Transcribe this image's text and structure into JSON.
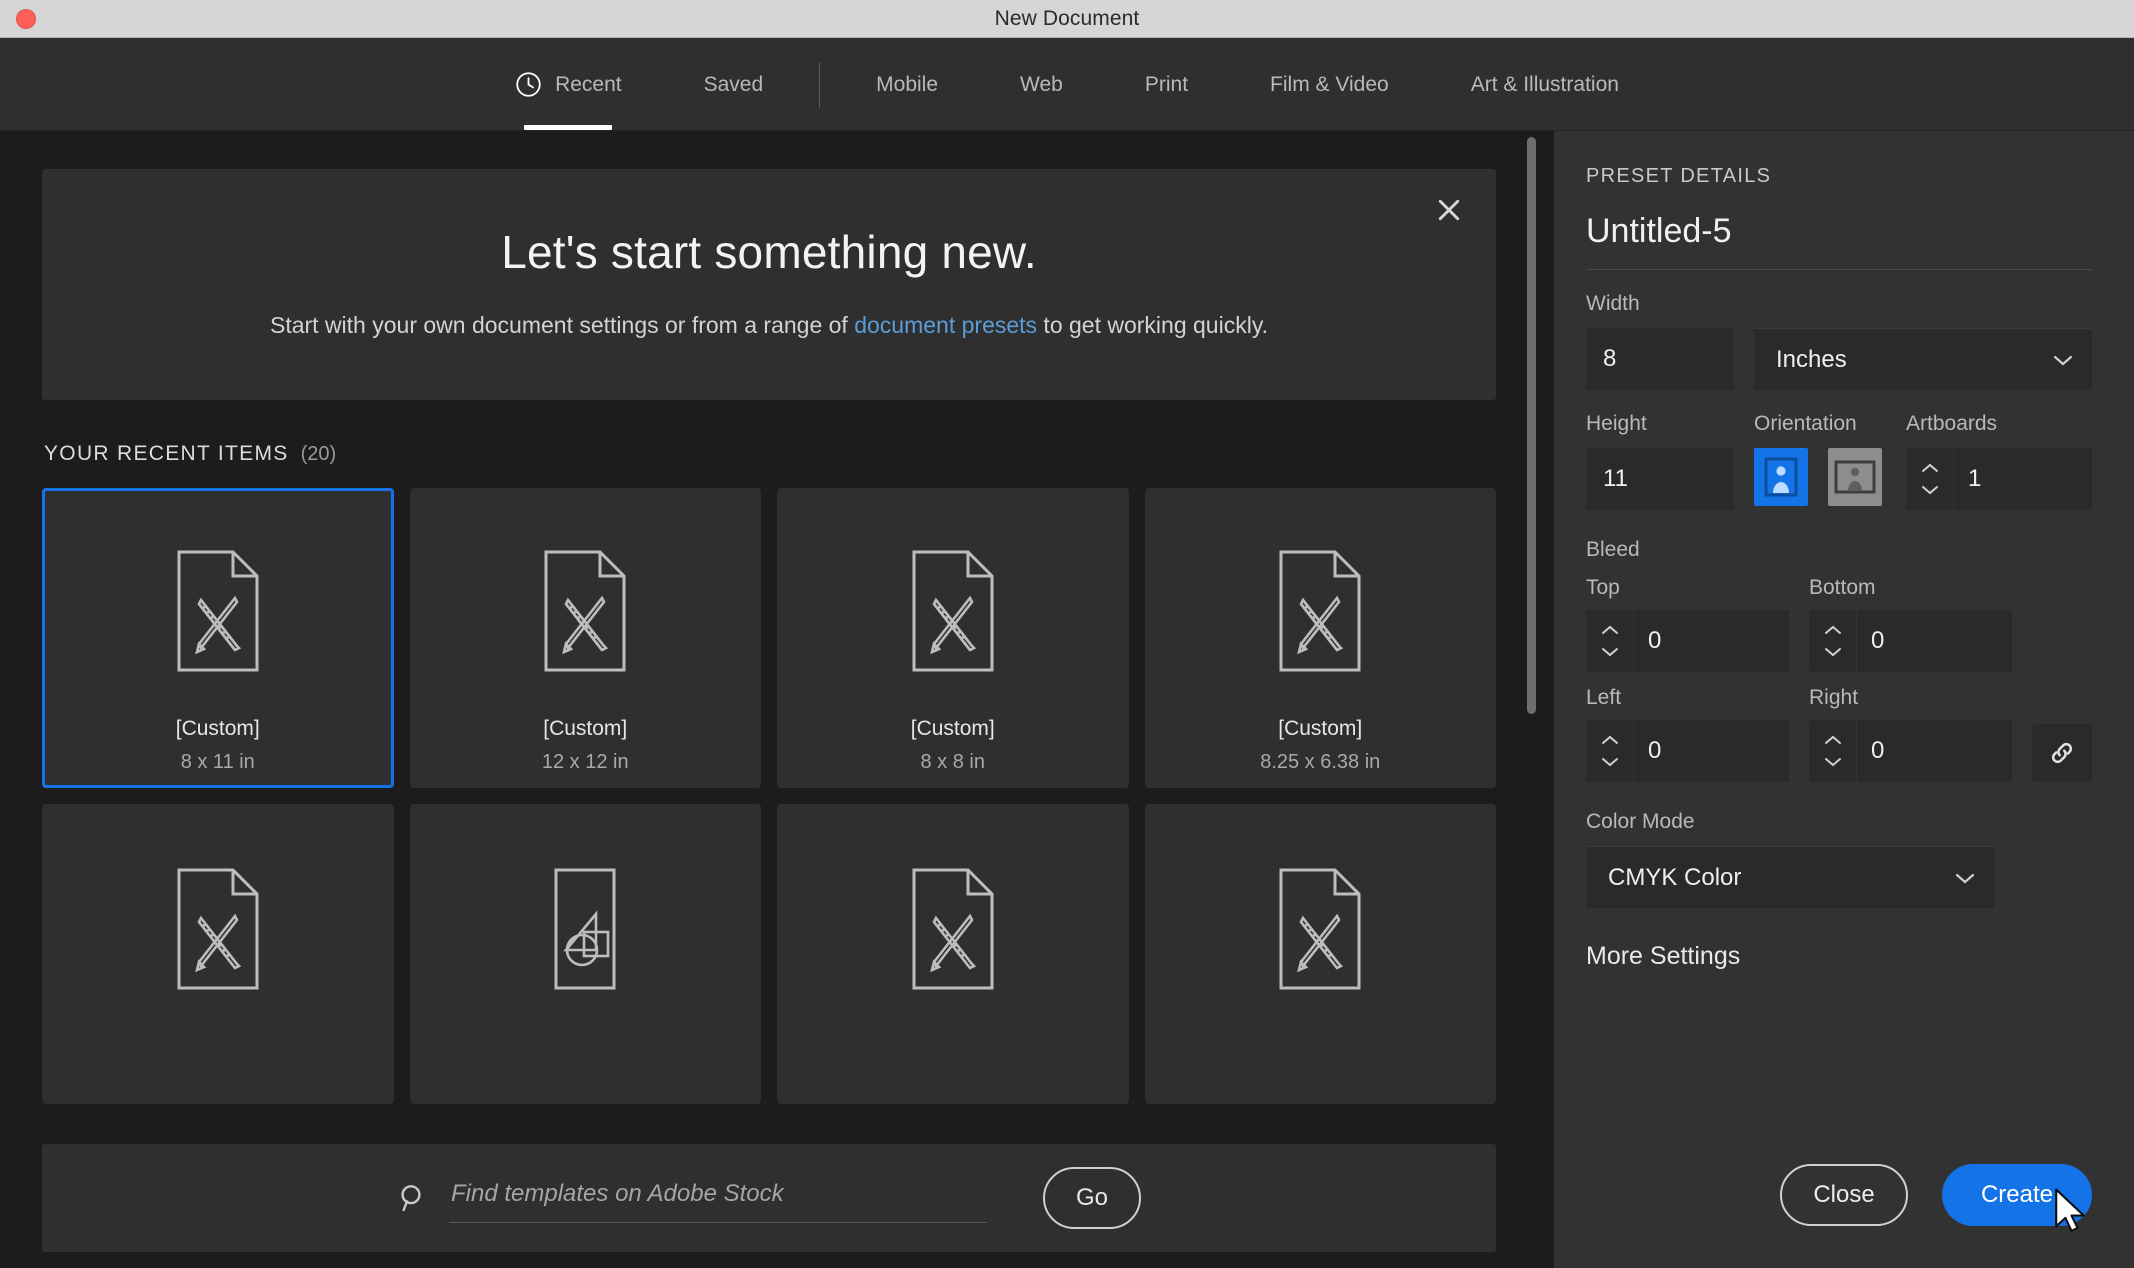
{
  "window": {
    "title": "New Document",
    "close_button": "close-window-button"
  },
  "tabs": [
    {
      "label": "Recent",
      "icon": "clock-icon",
      "active": true
    },
    {
      "label": "Saved",
      "icon": null,
      "active": false
    },
    {
      "label": "Mobile",
      "icon": null,
      "active": false
    },
    {
      "label": "Web",
      "icon": null,
      "active": false
    },
    {
      "label": "Print",
      "icon": null,
      "active": false
    },
    {
      "label": "Film & Video",
      "icon": null,
      "active": false
    },
    {
      "label": "Art & Illustration",
      "icon": null,
      "active": false
    }
  ],
  "hero": {
    "heading": "Let's start something new.",
    "body_before": "Start with your own document settings or from a range of ",
    "link": "document presets",
    "body_after": " to get working quickly.",
    "close_icon": "close-icon"
  },
  "recent": {
    "section_label": "YOUR RECENT ITEMS",
    "count": "(20)",
    "items": [
      {
        "name": "[Custom]",
        "dimensions": "8 x 11 in",
        "icon": "document-ruler-pencil-icon",
        "selected": true
      },
      {
        "name": "[Custom]",
        "dimensions": "12 x 12 in",
        "icon": "document-ruler-pencil-icon",
        "selected": false
      },
      {
        "name": "[Custom]",
        "dimensions": "8 x 8 in",
        "icon": "document-ruler-pencil-icon",
        "selected": false
      },
      {
        "name": "[Custom]",
        "dimensions": "8.25 x 6.38 in",
        "icon": "document-ruler-pencil-icon",
        "selected": false
      }
    ],
    "items_row2": [
      {
        "icon": "document-ruler-pencil-icon"
      },
      {
        "icon": "document-shapes-icon"
      },
      {
        "icon": "document-ruler-pencil-icon"
      },
      {
        "icon": "document-ruler-pencil-icon"
      }
    ]
  },
  "search": {
    "placeholder": "Find templates on Adobe Stock",
    "value": "",
    "go_label": "Go",
    "icon": "search-icon"
  },
  "preset": {
    "kicker": "PRESET DETAILS",
    "name": "Untitled-5",
    "width_label": "Width",
    "width_value": "8",
    "units_value": "Inches",
    "height_label": "Height",
    "height_value": "11",
    "orientation_label": "Orientation",
    "orientation_portrait": "portrait-icon",
    "orientation_landscape": "landscape-icon",
    "orientation_selected": "portrait",
    "artboards_label": "Artboards",
    "artboards_value": "1",
    "bleed_label": "Bleed",
    "bleed": {
      "top_label": "Top",
      "top_value": "0",
      "bottom_label": "Bottom",
      "bottom_value": "0",
      "left_label": "Left",
      "left_value": "0",
      "right_label": "Right",
      "right_value": "0",
      "link_icon": "link-chain-icon"
    },
    "color_mode_label": "Color Mode",
    "color_mode_value": "CMYK Color",
    "more_settings": "More Settings"
  },
  "actions": {
    "close": "Close",
    "create": "Create"
  },
  "colors": {
    "accent": "#1473e6",
    "panel_bg": "#323232",
    "main_bg": "#1c1c1c",
    "card_bg": "#2f2f2f",
    "link": "#5b9dd9",
    "titlebar": "#d6d6d6",
    "traffic_close": "#ff5f57"
  }
}
